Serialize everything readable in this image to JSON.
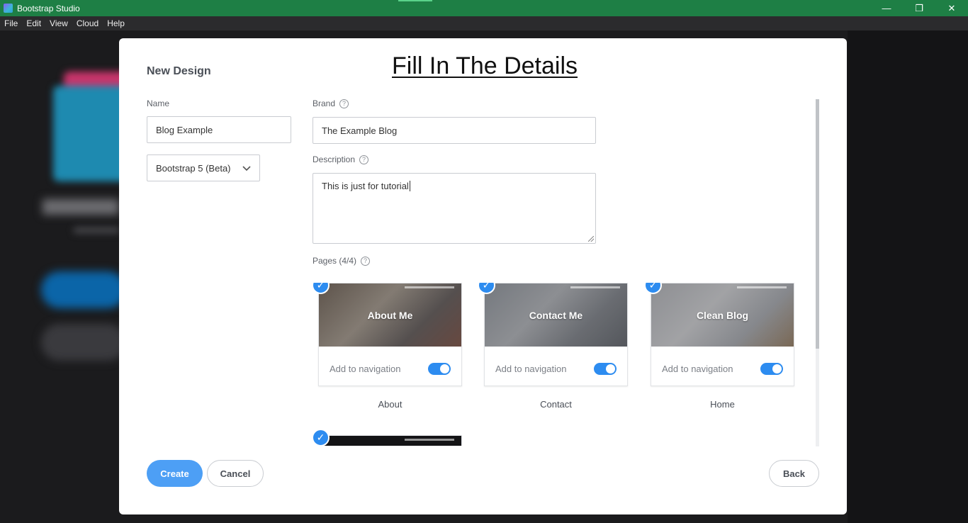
{
  "window": {
    "title": "Bootstrap Studio",
    "controls": {
      "minimize": "—",
      "restore": "❐",
      "close": "✕"
    }
  },
  "menu": [
    "File",
    "Edit",
    "View",
    "Cloud",
    "Help"
  ],
  "dialog": {
    "headline": "Fill In The Details",
    "title": "New Design",
    "name": {
      "label": "Name",
      "value": "Blog Example"
    },
    "framework": {
      "selected": "Bootstrap 5 (Beta)"
    },
    "brand": {
      "label": "Brand",
      "value": "The Example Blog"
    },
    "description": {
      "label": "Description",
      "value": "This is just for tutorial"
    },
    "pages": {
      "label": "Pages (4/4)",
      "nav_label": "Add to navigation",
      "items": [
        {
          "name": "About",
          "thumb_title": "About Me",
          "checked": true,
          "in_nav": true
        },
        {
          "name": "Contact",
          "thumb_title": "Contact Me",
          "checked": true,
          "in_nav": true
        },
        {
          "name": "Home",
          "thumb_title": "Clean Blog",
          "checked": true,
          "in_nav": true
        }
      ]
    },
    "buttons": {
      "create": "Create",
      "cancel": "Cancel",
      "back": "Back"
    }
  },
  "colors": {
    "titlebar": "#1e7f45",
    "accent": "#2d8cf0",
    "primary_button": "#4d9ff5"
  }
}
